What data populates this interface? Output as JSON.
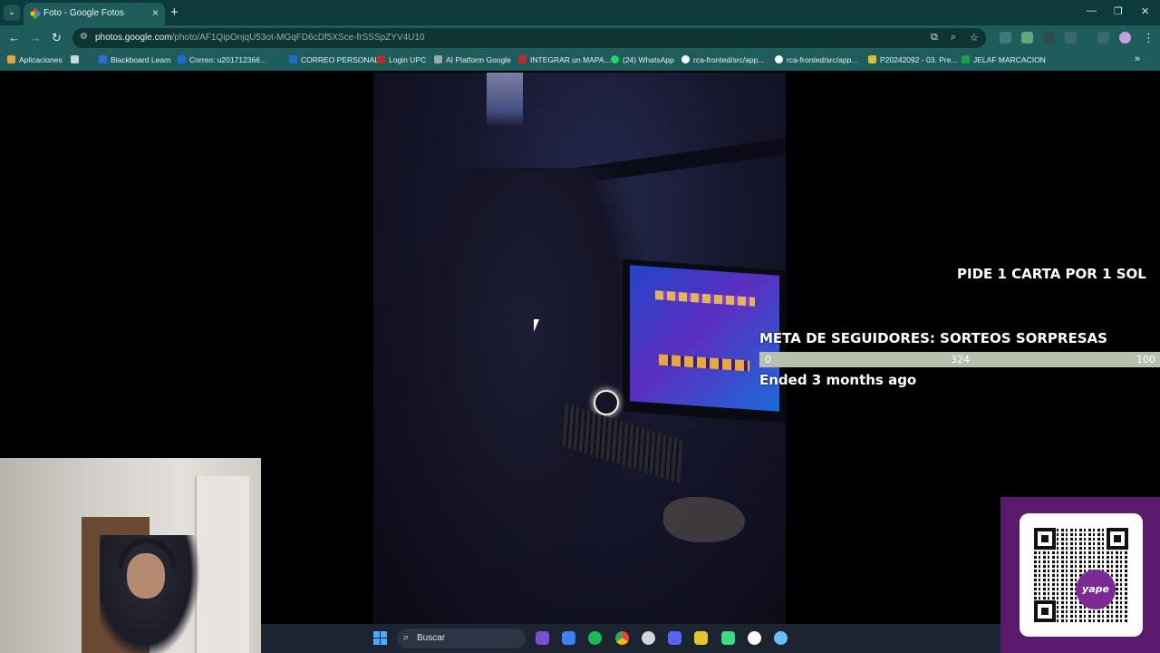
{
  "browser": {
    "tab_title": "Foto - Google Fotos",
    "url_host": "photos.google.com",
    "url_path": "/photo/AF1QipOnjqU53ot-MGqFD6cDf5XSce-frSSSpZYV4U10"
  },
  "bookmarks": [
    {
      "label": "Aplicaciones",
      "color": "#e8a23a"
    },
    {
      "label": "",
      "color": "#c9d6d6"
    },
    {
      "label": "Blackboard Learn",
      "color": "#2d6fd6"
    },
    {
      "label": "Correo: u201712366...",
      "color": "#1f6cd1"
    },
    {
      "label": "CORREO PERSONAL",
      "color": "#1f6cd1"
    },
    {
      "label": "Login UPC",
      "color": "#b72b2b"
    },
    {
      "label": "AI Platform Google",
      "color": "#9aa"
    },
    {
      "label": "INTEGRAR un MAPA...",
      "color": "#c02a2a"
    },
    {
      "label": "(24) WhatsApp",
      "color": "#25d366"
    },
    {
      "label": "rca-fronted/src/app...",
      "color": "#ffffff"
    },
    {
      "label": "rca-fronted/src/app...",
      "color": "#ffffff"
    },
    {
      "label": "P20242092 - 03. Pre...",
      "color": "#d6c02d"
    },
    {
      "label": "JELAF MARCACION",
      "color": "#1e9e4a"
    }
  ],
  "overlays": {
    "card_offer": "PIDE 1 CARTA POR 1 SOL",
    "goal_title": "META DE SEGUIDORES: SORTEOS SORPRESAS",
    "goal_min": "0",
    "goal_current": "324",
    "goal_max": "100",
    "goal_status": "Ended 3 months ago"
  },
  "qr": {
    "logo_text": "yape",
    "brand_color": "#5a1a6e"
  },
  "taskbar": {
    "search_placeholder": "Buscar",
    "apps": [
      {
        "name": "sublime-icon",
        "color": "#7a4fd6"
      },
      {
        "name": "shield-icon",
        "color": "#3b82f6"
      },
      {
        "name": "spotify-icon",
        "color": "#1db954"
      },
      {
        "name": "chrome-icon",
        "color": "#e94335"
      },
      {
        "name": "github-icon",
        "color": "#d4d4dc"
      },
      {
        "name": "discord-icon",
        "color": "#5865f2"
      },
      {
        "name": "bolt-icon",
        "color": "#e5c52a"
      },
      {
        "name": "android-icon",
        "color": "#3ddc84"
      },
      {
        "name": "logitech-icon",
        "color": "#ffffff"
      },
      {
        "name": "steam-icon",
        "color": "#66c0f4"
      }
    ]
  }
}
